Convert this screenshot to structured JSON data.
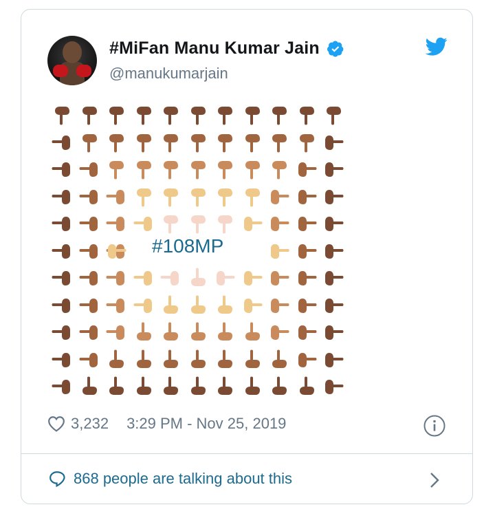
{
  "tweet": {
    "author_name": "#MiFan Manu Kumar Jain",
    "handle": "@manukumarjain",
    "hashtag": "#108MP",
    "likes": "3,232",
    "timestamp": "3:29 PM - Nov 25, 2019",
    "talking": "868 people are talking about this"
  },
  "colors": {
    "accent": "#1da1f2",
    "link": "#1b6a8f",
    "muted": "#657786",
    "border": "#cfd9de",
    "skin_tones": [
      "#7a4a32",
      "#a0653f",
      "#c98b5c",
      "#efc98a",
      "#f6d6c8"
    ]
  },
  "icons": {
    "verified": "verified-badge-icon",
    "twitter": "twitter-bird-icon",
    "heart": "heart-icon",
    "info": "info-icon",
    "reply": "speech-bubble-icon",
    "chevron": "chevron-right-icon"
  }
}
